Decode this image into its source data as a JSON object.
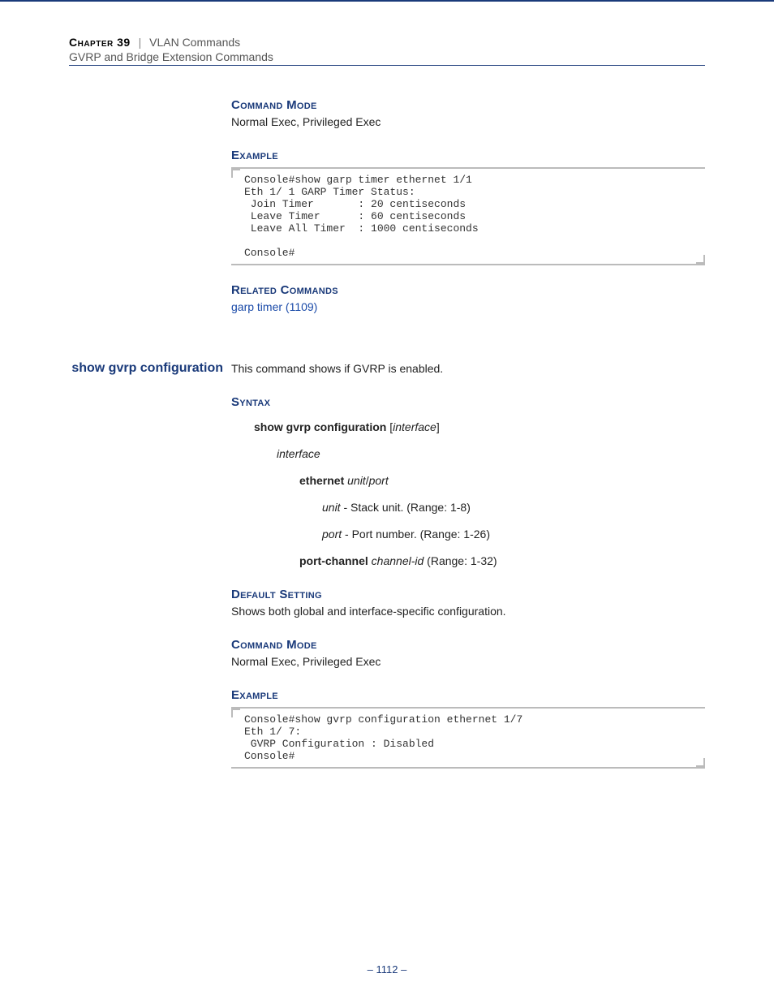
{
  "header": {
    "chapter": "Chapter 39",
    "separator": "|",
    "topic": "VLAN Commands",
    "subtitle": "GVRP and Bridge Extension Commands"
  },
  "sec1": {
    "cmdmode_h": "Command Mode",
    "cmdmode_t": "Normal Exec, Privileged Exec",
    "example_h": "Example",
    "code": "Console#show garp timer ethernet 1/1\nEth 1/ 1 GARP Timer Status:\n Join Timer       : 20 centiseconds\n Leave Timer      : 60 centiseconds\n Leave All Timer  : 1000 centiseconds\n\nConsole#",
    "related_h": "Related Commands",
    "related_link": "garp timer (1109)"
  },
  "sec2": {
    "side_label": "show gvrp configuration",
    "intro": "This command shows if GVRP is enabled.",
    "syntax_h": "Syntax",
    "syntax_cmd_b": "show gvrp configuration",
    "syntax_cmd_br1": " [",
    "syntax_cmd_i": "interface",
    "syntax_cmd_br2": "]",
    "syntax_l1_i": "interface",
    "syntax_l2_b": "ethernet",
    "syntax_l2_i1": "unit",
    "syntax_l2_sep": "/",
    "syntax_l2_i2": "port",
    "syntax_l3a_i": "unit",
    "syntax_l3a_t": " - Stack unit. (Range: 1-8)",
    "syntax_l3b_i": "port",
    "syntax_l3b_t": " - Port number. (Range: 1-26)",
    "syntax_l4_b": "port-channel",
    "syntax_l4_i": "channel-id",
    "syntax_l4_t": " (Range: 1-32)",
    "default_h": "Default Setting",
    "default_t": "Shows both global and interface-specific configuration.",
    "cmdmode_h": "Command Mode",
    "cmdmode_t": "Normal Exec, Privileged Exec",
    "example_h": "Example",
    "code": "Console#show gvrp configuration ethernet 1/7\nEth 1/ 7:\n GVRP Configuration : Disabled\nConsole#"
  },
  "page_number": "– 1112 –"
}
